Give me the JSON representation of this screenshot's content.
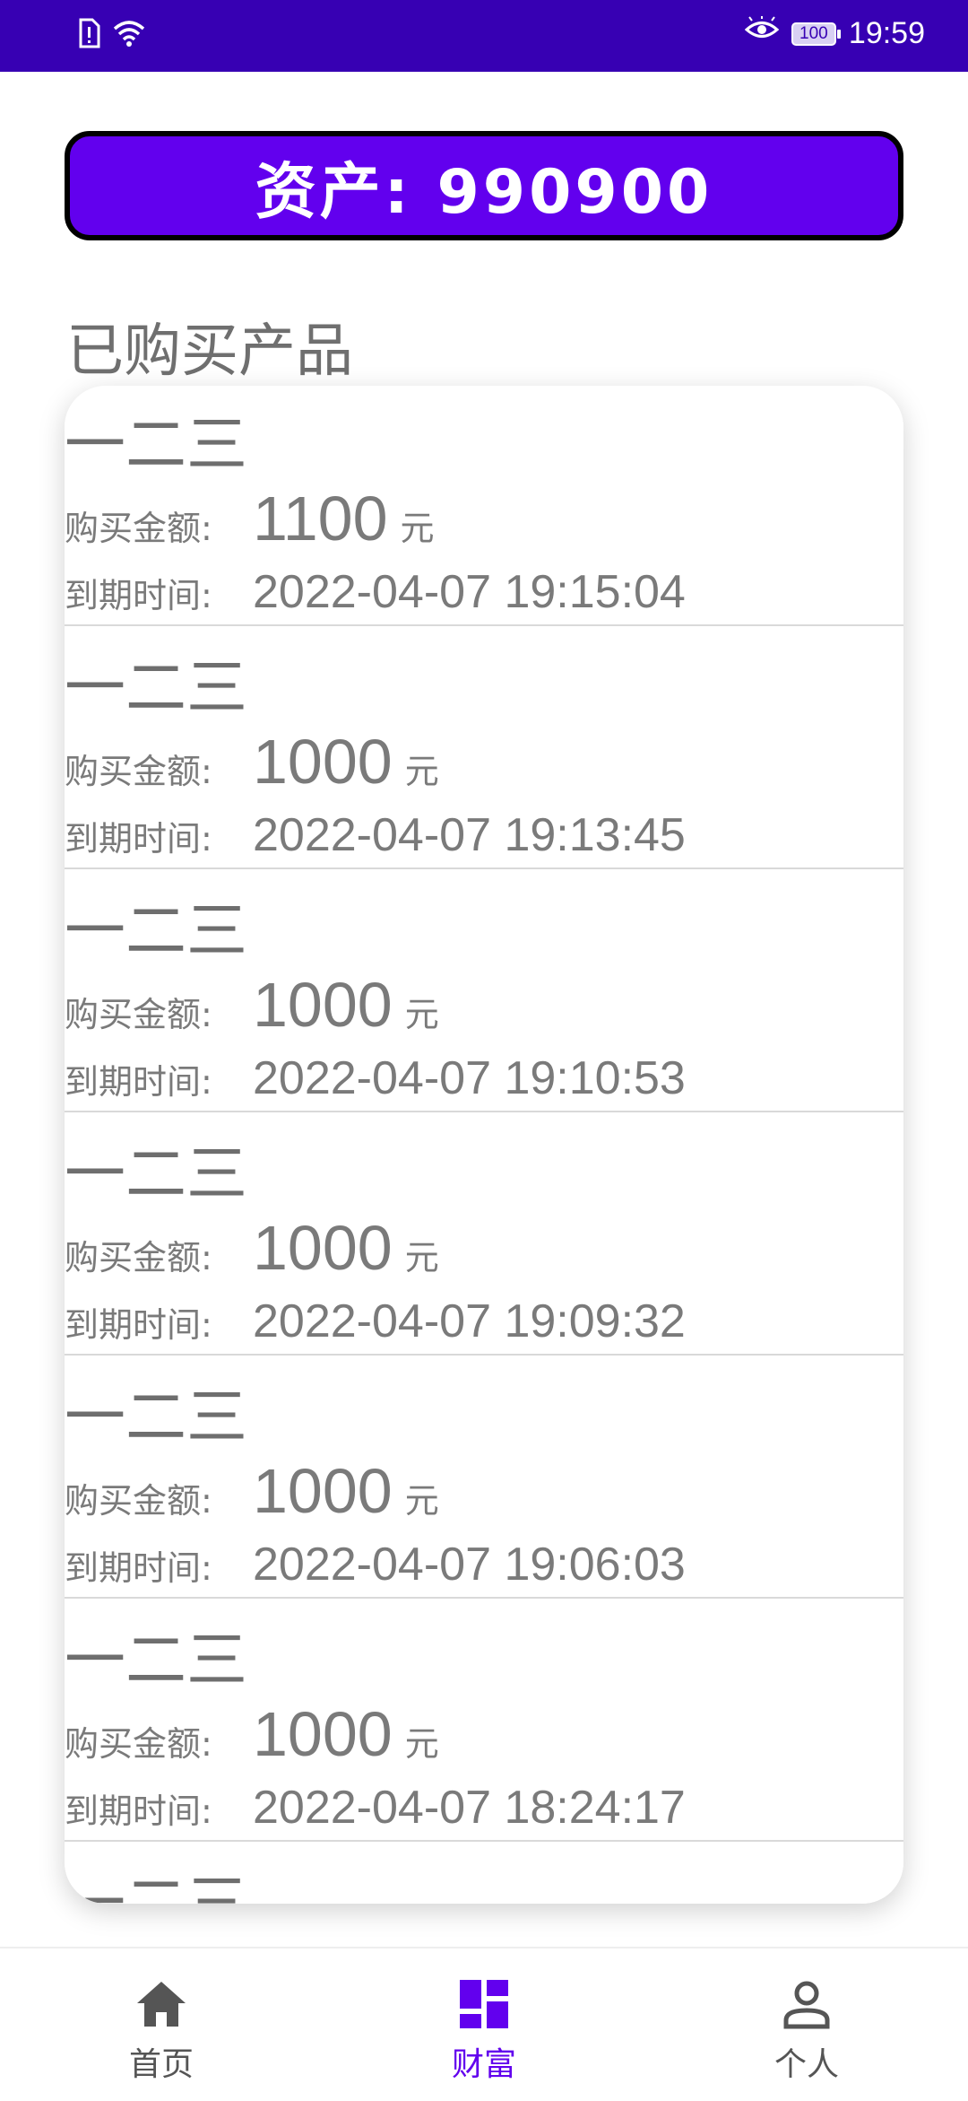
{
  "status_bar": {
    "time": "19:59",
    "battery": "100",
    "icons": [
      "sim-alert-icon",
      "wifi-icon",
      "eye-comfort-icon",
      "battery-icon"
    ]
  },
  "asset": {
    "label": "资产: 990900"
  },
  "section_title": "已购买产品",
  "labels": {
    "amount": "购买金额:",
    "expire": "到期时间:",
    "unit": "元"
  },
  "products": [
    {
      "name": "一二三",
      "amount": "1100",
      "expire": "2022-04-07 19:15:04"
    },
    {
      "name": "一二三",
      "amount": "1000",
      "expire": "2022-04-07 19:13:45"
    },
    {
      "name": "一二三",
      "amount": "1000",
      "expire": "2022-04-07 19:10:53"
    },
    {
      "name": "一二三",
      "amount": "1000",
      "expire": "2022-04-07 19:09:32"
    },
    {
      "name": "一二三",
      "amount": "1000",
      "expire": "2022-04-07 19:06:03"
    },
    {
      "name": "一二三",
      "amount": "1000",
      "expire": "2022-04-07 18:24:17"
    },
    {
      "name": "一二三"
    }
  ],
  "bottom_nav": {
    "items": [
      {
        "label": "首页",
        "icon": "home-icon",
        "active": false
      },
      {
        "label": "财富",
        "icon": "dashboard-icon",
        "active": true
      },
      {
        "label": "个人",
        "icon": "person-icon",
        "active": false
      }
    ],
    "active_color": "#6200ee",
    "inactive_color": "#555555"
  },
  "colors": {
    "status_bar": "#3700b3",
    "banner": "#6200ee",
    "text": "#777777"
  }
}
